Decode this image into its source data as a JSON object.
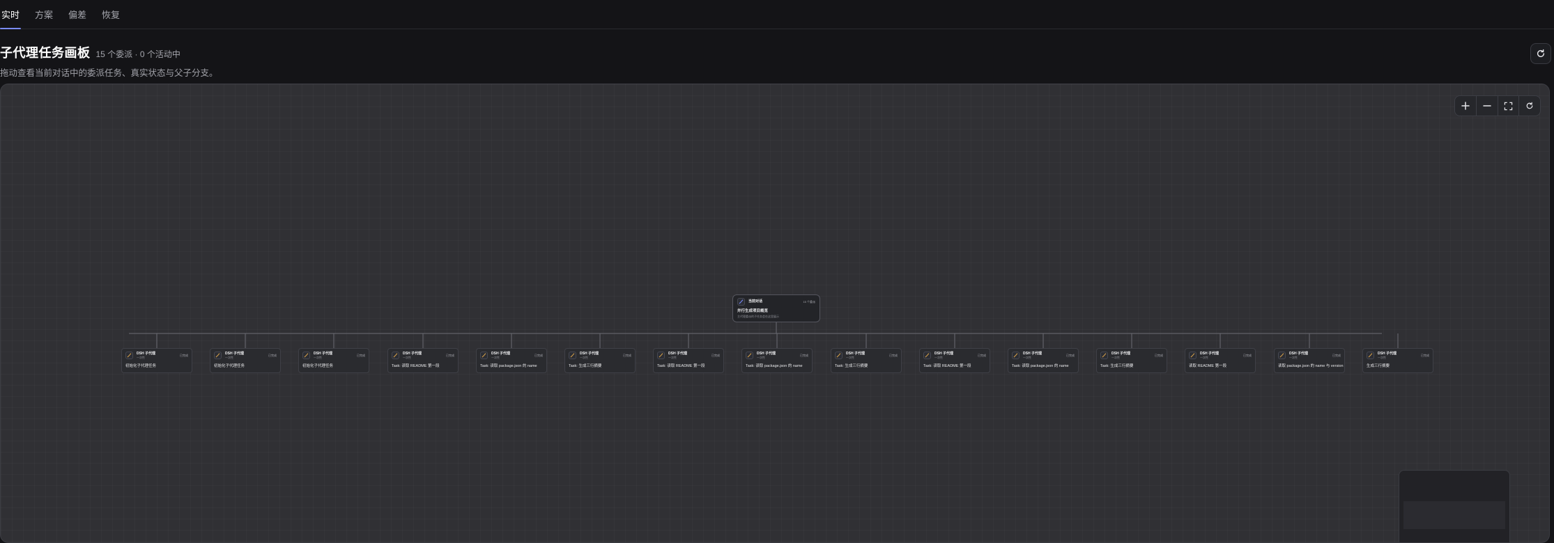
{
  "tabs": [
    "实时",
    "方案",
    "偏差",
    "恢复"
  ],
  "header": {
    "title": "子代理任务画板",
    "stats": "15 个委派 · 0 个活动中",
    "subtitle": "拖动查看当前对话中的委派任务、真实状态与父子分支。"
  },
  "root": {
    "name": "当前对话",
    "badge": "15 个委派",
    "task": "并行生成项目概览",
    "description": "主代理委派的子任务会在这里展示"
  },
  "child_label": "DSH 子代理",
  "child_sub": "一次性",
  "child_status": "已完成",
  "children": [
    {
      "task": "初始化子代理任务"
    },
    {
      "task": "初始化子代理任务"
    },
    {
      "task": "初始化子代理任务"
    },
    {
      "task": "Task: 读取 README 第一段"
    },
    {
      "task": "Task: 读取 package.json 的 name"
    },
    {
      "task": "Task: 生成三行摘要"
    },
    {
      "task": "Task: 读取 README 第一段"
    },
    {
      "task": "Task: 读取 package.json 的 name"
    },
    {
      "task": "Task: 生成三行摘要"
    },
    {
      "task": "Task: 读取 README 第一段"
    },
    {
      "task": "Task: 读取 package.json 的 name"
    },
    {
      "task": "Task: 生成三行摘要"
    },
    {
      "task": "读取 README 第一段"
    },
    {
      "task": "读取 package.json 的 name 与 version"
    },
    {
      "task": "生成三行摘要"
    }
  ],
  "colors": {
    "accent": "#7b8cff",
    "canvas": "#303034",
    "node_icon": "#d8a24a"
  },
  "icons": {
    "refresh": "refresh-icon",
    "zoom_in": "plus-icon",
    "zoom_out": "minus-icon",
    "fit": "fullscreen-icon",
    "reset": "reset-icon",
    "node": "agent-icon"
  }
}
